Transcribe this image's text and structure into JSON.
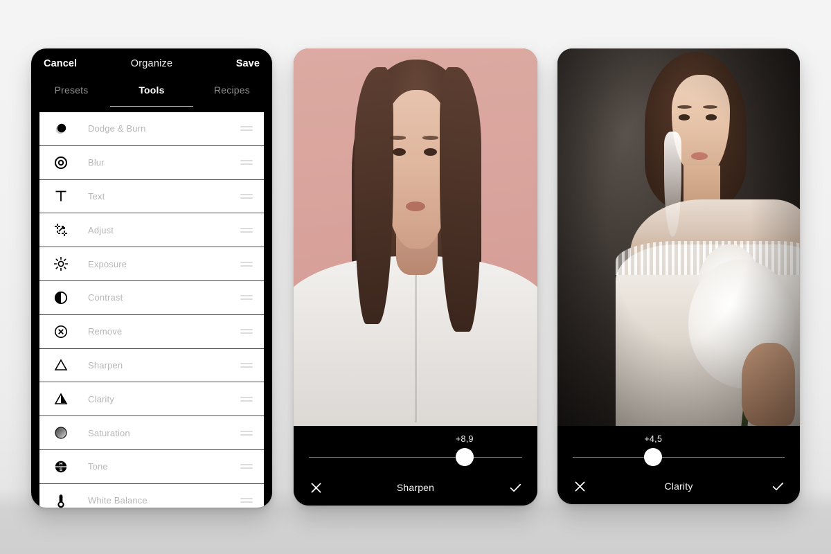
{
  "scene": {
    "background_top": "#f4f4f4",
    "background_bottom": "#cfcfcf"
  },
  "phone1": {
    "header": {
      "cancel_label": "Cancel",
      "title": "Organize",
      "save_label": "Save"
    },
    "tabs": [
      {
        "label": "Presets",
        "active": false
      },
      {
        "label": "Tools",
        "active": true
      },
      {
        "label": "Recipes",
        "active": false
      }
    ],
    "tools": [
      {
        "label": "Dodge & Burn",
        "icon": "dodge-burn-icon"
      },
      {
        "label": "Blur",
        "icon": "blur-icon"
      },
      {
        "label": "Text",
        "icon": "text-icon"
      },
      {
        "label": "Adjust",
        "icon": "adjust-crop-icon"
      },
      {
        "label": "Exposure",
        "icon": "exposure-sun-icon"
      },
      {
        "label": "Contrast",
        "icon": "contrast-icon"
      },
      {
        "label": "Remove",
        "icon": "remove-icon"
      },
      {
        "label": "Sharpen",
        "icon": "sharpen-triangle-icon"
      },
      {
        "label": "Clarity",
        "icon": "clarity-triangle-icon"
      },
      {
        "label": "Saturation",
        "icon": "saturation-icon"
      },
      {
        "label": "Tone",
        "icon": "tone-hsl-icon"
      },
      {
        "label": "White Balance",
        "icon": "white-balance-thermometer-icon"
      }
    ]
  },
  "phone2": {
    "adjustment": {
      "name": "Sharpen",
      "value": "+8,9",
      "slider_percent": 73
    },
    "cancel_icon": "close-icon",
    "confirm_icon": "check-icon"
  },
  "phone3": {
    "adjustment": {
      "name": "Clarity",
      "value": "+4,5",
      "slider_percent": 38
    },
    "cancel_icon": "close-icon",
    "confirm_icon": "check-icon"
  }
}
